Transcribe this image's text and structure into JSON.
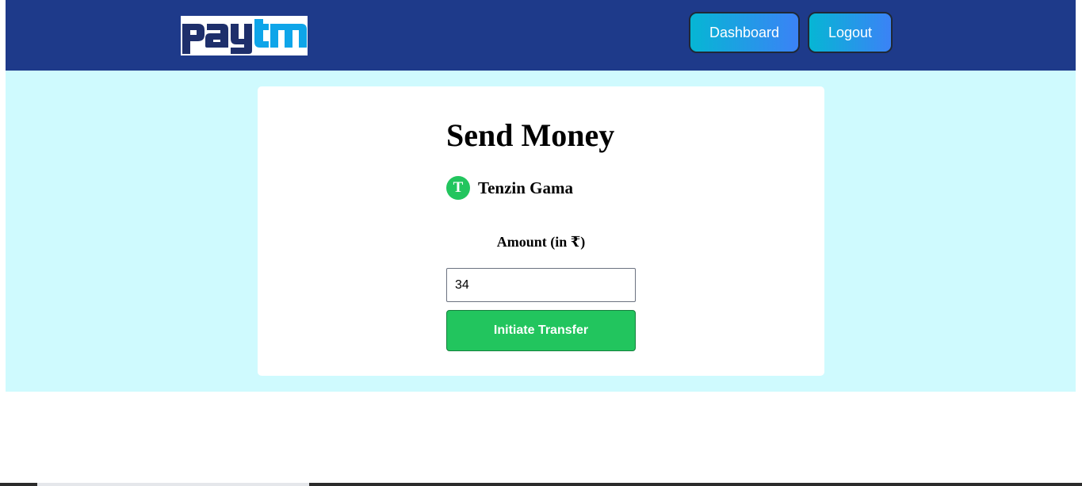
{
  "header": {
    "logo_text": "paytm",
    "dashboard_label": "Dashboard",
    "logout_label": "Logout"
  },
  "colors": {
    "navbar": "#1e3a8a",
    "page_background": "#cffafe",
    "accent_green": "#22c55e",
    "logo_dark": "#1e2f6b",
    "logo_light": "#0ea5e9"
  },
  "send_money": {
    "title": "Send Money",
    "recipient_initial": "T",
    "recipient_name": "Tenzin Gama",
    "amount_label": "Amount (in ₹)",
    "amount_value": "34",
    "transfer_label": "Initiate Transfer"
  }
}
